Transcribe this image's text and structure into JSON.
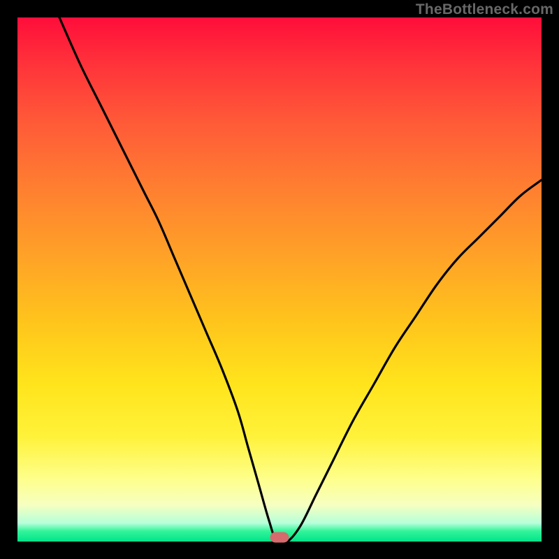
{
  "watermark": "TheBottleneck.com",
  "chart_data": {
    "type": "line",
    "title": "",
    "xlabel": "",
    "ylabel": "",
    "xlim": [
      0,
      100
    ],
    "ylim": [
      0,
      100
    ],
    "grid": false,
    "legend": false,
    "background_gradient": {
      "top_color": "#ff0d3a",
      "mid_color": "#ffe41c",
      "bottom_color": "#00e389"
    },
    "marker": {
      "x": 50,
      "y": 0,
      "color": "#d66a6c"
    },
    "series": [
      {
        "name": "bottleneck-curve",
        "color": "#000000",
        "x": [
          8,
          12,
          16,
          20,
          24,
          27,
          30,
          33,
          36,
          39,
          42,
          44,
          46,
          48,
          49.5,
          51.5,
          54,
          57,
          60,
          64,
          68,
          72,
          76,
          80,
          84,
          88,
          92,
          96,
          100
        ],
        "y": [
          100,
          91,
          83,
          75,
          67,
          61,
          54,
          47,
          40,
          33,
          25,
          18,
          11,
          4,
          0,
          0,
          3,
          9,
          15,
          23,
          30,
          37,
          43,
          49,
          54,
          58,
          62,
          66,
          69
        ]
      }
    ]
  }
}
